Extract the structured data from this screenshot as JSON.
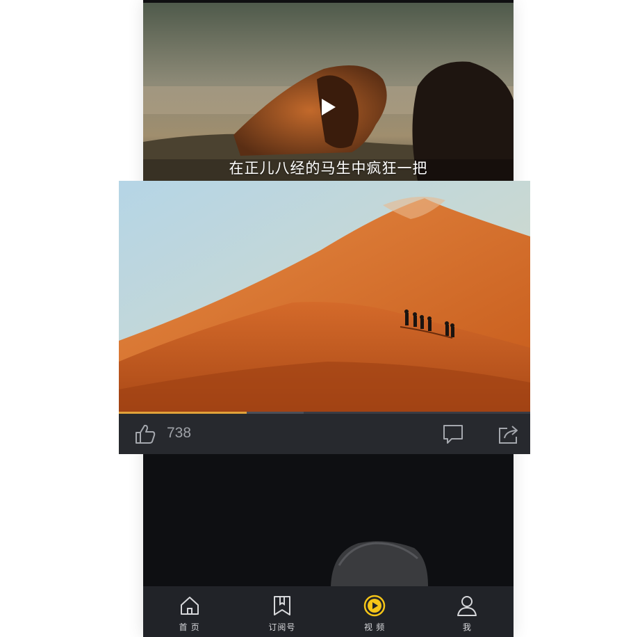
{
  "top_video": {
    "caption": "在正儿八经的马生中疯狂一把",
    "play_icon": "play-icon"
  },
  "main_video": {
    "progress_played": 0.31,
    "progress_buffered": 0.45
  },
  "actions": {
    "like_count": "738",
    "like_icon": "thumbs-up-icon",
    "comment_icon": "comment-icon",
    "share_icon": "share-icon"
  },
  "tabbar": {
    "tabs": [
      {
        "label": "首 页",
        "icon": "home-icon"
      },
      {
        "label": "订阅号",
        "icon": "bookmark-icon"
      },
      {
        "label": "视 频",
        "icon": "video-play-icon",
        "active": true
      },
      {
        "label": "我",
        "icon": "user-icon"
      }
    ],
    "accent": "#f5c518"
  }
}
